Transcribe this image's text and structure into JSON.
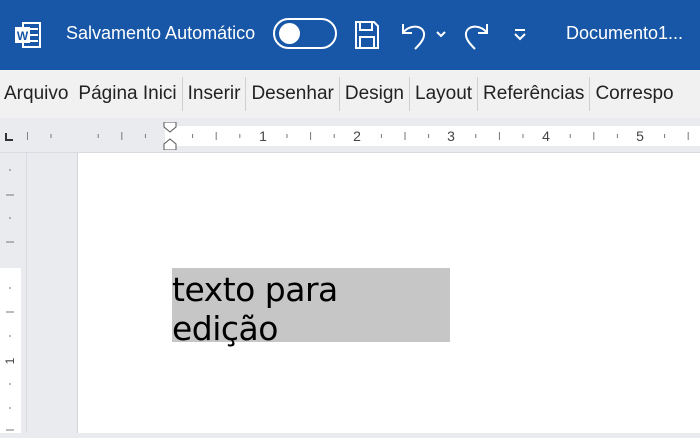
{
  "titlebar": {
    "autosave_label": "Salvamento Automático",
    "autosave_on": false,
    "doc_title": "Documento1...",
    "accent": "#1857a7"
  },
  "tabs": [
    "Arquivo",
    "Página Inici",
    "Inserir",
    "Desenhar",
    "Design",
    "Layout",
    "Referências",
    "Correspo"
  ],
  "ruler": {
    "labels": [
      "1",
      "2",
      "3",
      "4",
      "5"
    ],
    "vertical_labels": [
      "1"
    ]
  },
  "document": {
    "selected_text": "texto para edição",
    "selection_color": "#c6c6c6"
  }
}
